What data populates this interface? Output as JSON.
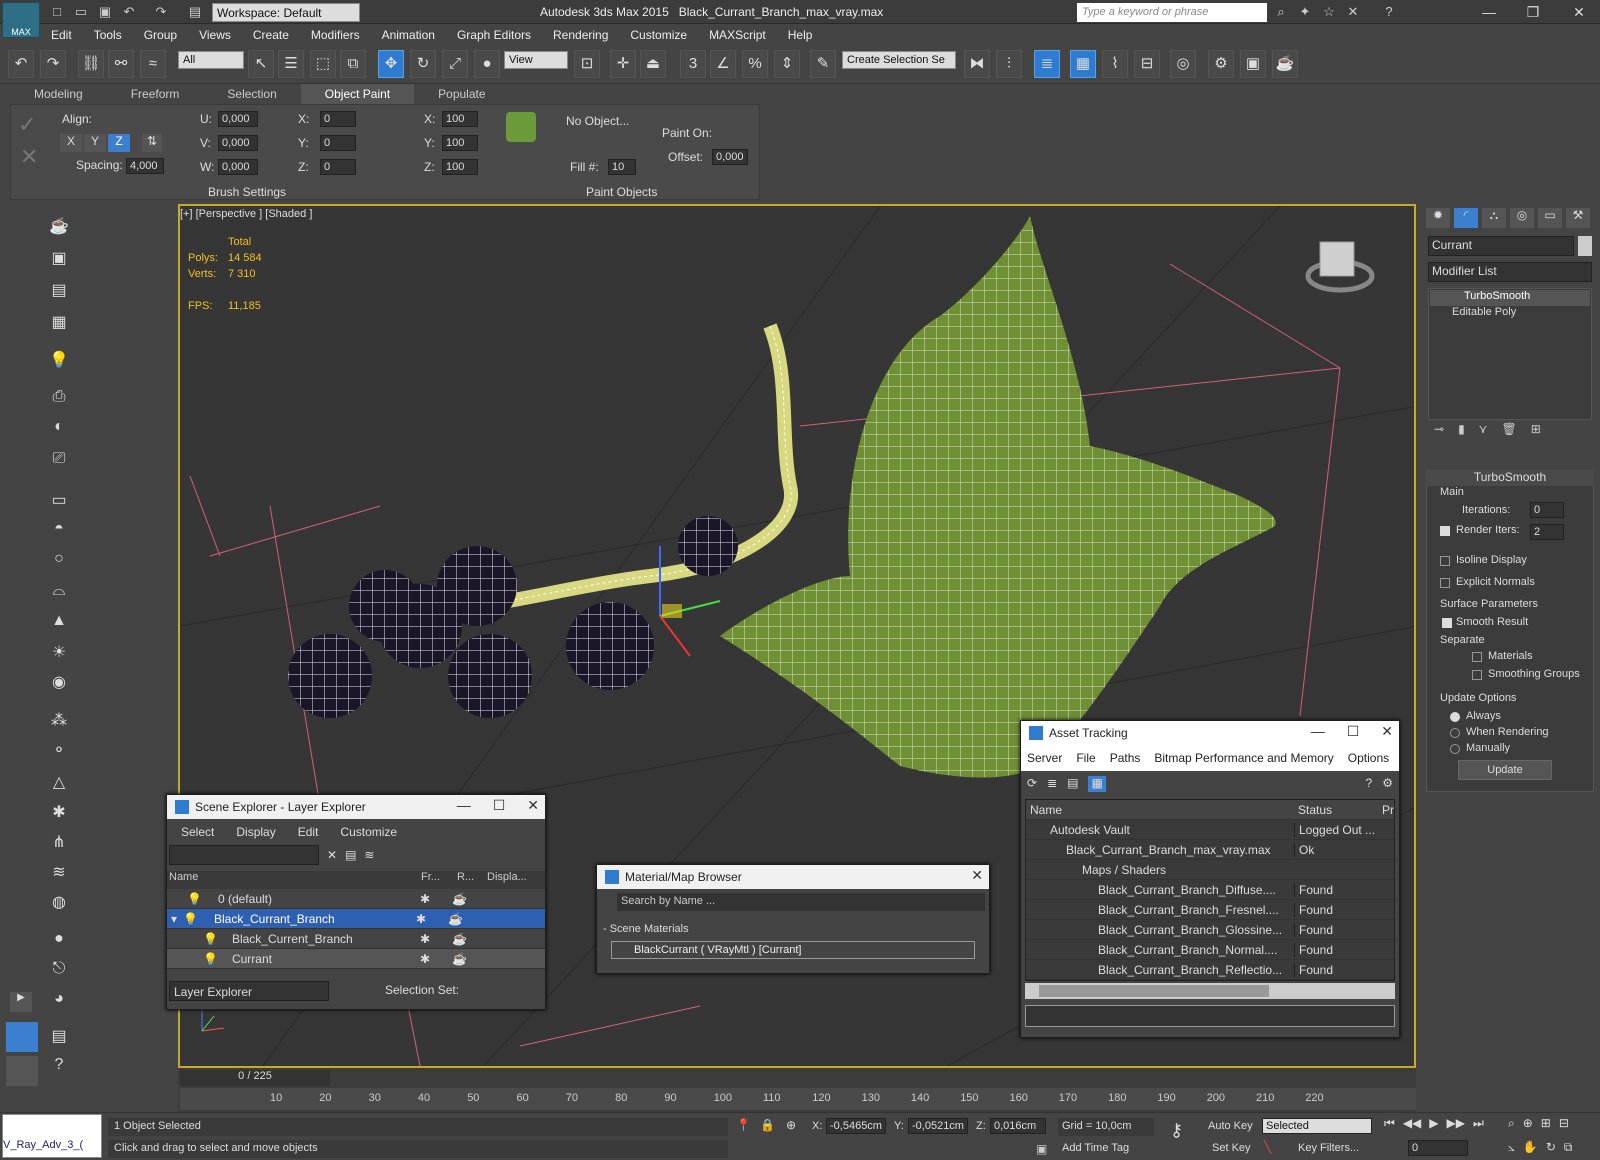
{
  "title": {
    "app": "Autodesk 3ds Max  2015",
    "file": "Black_Currant_Branch_max_vray.max",
    "workspace": "Workspace: Default",
    "search_placeholder": "Type a keyword or phrase",
    "logo": "MAX"
  },
  "menu": [
    "Edit",
    "Tools",
    "Group",
    "Views",
    "Create",
    "Modifiers",
    "Animation",
    "Graph Editors",
    "Rendering",
    "Customize",
    "MAXScript",
    "Help"
  ],
  "toolbar": {
    "filter": "All",
    "view": "View",
    "selection_set": "Create Selection Se"
  },
  "ribbon": {
    "tabs": [
      "Modeling",
      "Freeform",
      "Selection",
      "Object Paint",
      "Populate"
    ],
    "align": "Align:",
    "spacing": "Spacing:",
    "spacing_val": "4,000",
    "u": "U:",
    "u_val": "0,000",
    "v": "V:",
    "v_val": "0,000",
    "w": "W:",
    "w_val": "0,000",
    "x": "X:",
    "x_val": "0",
    "y": "Y:",
    "y_val": "0",
    "z": "Z:",
    "z_val": "0",
    "sx": "X:",
    "sx_val": "100",
    "sy": "Y:",
    "sy_val": "100",
    "sz": "Z:",
    "sz_val": "100",
    "brush_settings": "Brush Settings",
    "no_object": "No Object...",
    "fill": "Fill #:",
    "fill_val": "10",
    "paint_on": "Paint On:",
    "offset": "Offset:",
    "offset_val": "0,000",
    "paint_objects": "Paint Objects"
  },
  "viewport": {
    "label": "[+] [Perspective ] [Shaded ]",
    "total": "Total",
    "polys_label": "Polys:",
    "polys": "14 584",
    "verts_label": "Verts:",
    "verts": "7 310",
    "fps_label": "FPS:",
    "fps": "11,185"
  },
  "command_panel": {
    "object_name": "Currant",
    "modifier_list": "Modifier List",
    "stack": [
      "TurboSmooth",
      "Editable Poly"
    ],
    "rollout": "TurboSmooth",
    "main": "Main",
    "iterations": "Iterations:",
    "iterations_val": "0",
    "render_iters": "Render Iters:",
    "render_iters_val": "2",
    "isoline": "Isoline Display",
    "explicit": "Explicit Normals",
    "surface": "Surface Parameters",
    "smooth_result": "Smooth Result",
    "separate": "Separate",
    "materials": "Materials",
    "smoothing_groups": "Smoothing Groups",
    "update_options": "Update Options",
    "always": "Always",
    "when_rendering": "When Rendering",
    "manually": "Manually",
    "update": "Update"
  },
  "scene_explorer": {
    "title": "Scene Explorer - Layer Explorer",
    "menu": [
      "Select",
      "Display",
      "Edit",
      "Customize"
    ],
    "cols": [
      "Name",
      "Fr...",
      "R...",
      "Displa..."
    ],
    "rows": [
      "0 (default)",
      "Black_Currant_Branch",
      "Black_Current_Branch",
      "Currant"
    ],
    "footer": "Layer Explorer",
    "selection_set": "Selection Set:"
  },
  "material_browser": {
    "title": "Material/Map Browser",
    "search": "Search by Name ...",
    "section": "- Scene Materials",
    "item": "BlackCurrant  ( VRayMtl )  [Currant]"
  },
  "asset_tracking": {
    "title": "Asset Tracking",
    "menu": [
      "Server",
      "File",
      "Paths",
      "Bitmap Performance and Memory",
      "Options"
    ],
    "cols": [
      "Name",
      "Status",
      "Pr"
    ],
    "rows": [
      {
        "name": "Autodesk Vault",
        "status": "Logged Out ..."
      },
      {
        "name": "Black_Currant_Branch_max_vray.max",
        "status": "Ok"
      },
      {
        "name": "Maps / Shaders",
        "status": ""
      },
      {
        "name": "Black_Currant_Branch_Diffuse....",
        "status": "Found"
      },
      {
        "name": "Black_Currant_Branch_Fresnel....",
        "status": "Found"
      },
      {
        "name": "Black_Currant_Branch_Glossine...",
        "status": "Found"
      },
      {
        "name": "Black_Currant_Branch_Normal....",
        "status": "Found"
      },
      {
        "name": "Black_Currant_Branch_Reflectio...",
        "status": "Found"
      }
    ]
  },
  "timeline": {
    "frame": "0 / 225",
    "ticks": [
      "10",
      "20",
      "30",
      "40",
      "50",
      "60",
      "70",
      "80",
      "90",
      "100",
      "110",
      "120",
      "130",
      "140",
      "150",
      "160",
      "170",
      "180",
      "190",
      "200",
      "210",
      "220"
    ]
  },
  "status": {
    "script": "V_Ray_Adv_3_(",
    "selected": "1 Object Selected",
    "prompt": "Click and drag to select and move objects",
    "x": "X:",
    "x_val": "-0,5465cm",
    "y": "Y:",
    "y_val": "-0,0521cm",
    "z": "Z:",
    "z_val": "0,016cm",
    "grid": "Grid = 10,0cm",
    "add_time_tag": "Add Time Tag",
    "auto_key": "Auto Key",
    "set_key": "Set Key",
    "selected_dd": "Selected",
    "key_filters": "Key Filters...",
    "frame_val": "0"
  }
}
